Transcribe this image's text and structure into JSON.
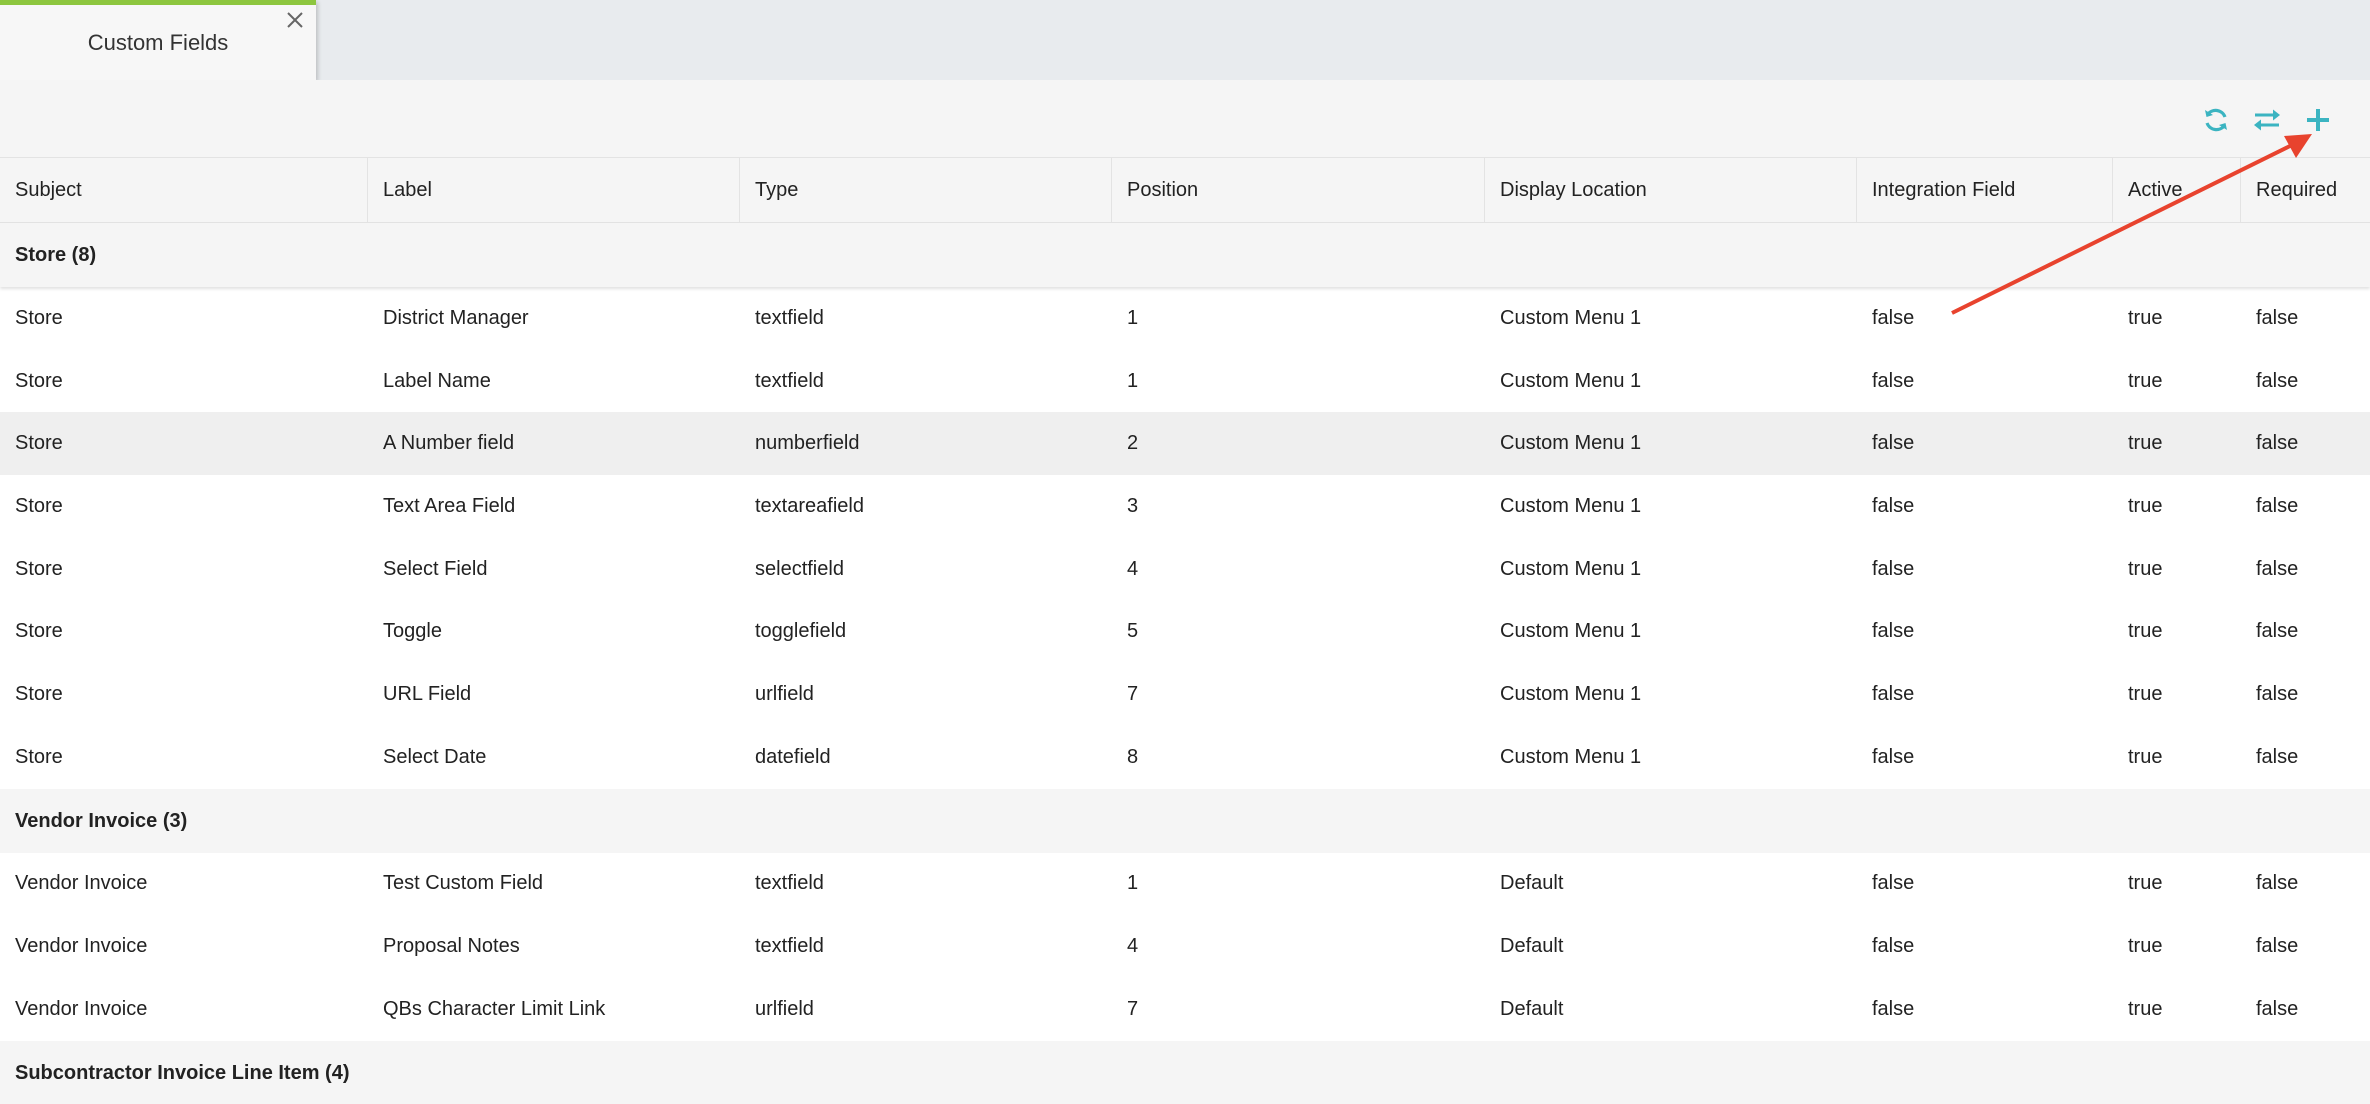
{
  "tab": {
    "label": "Custom Fields"
  },
  "toolbar": {
    "icons": [
      "refresh-icon",
      "swap-icon",
      "plus-icon"
    ],
    "accent": "#3bb4c1"
  },
  "columns": [
    "Subject",
    "Label",
    "Type",
    "Position",
    "Display Location",
    "Integration Field",
    "Active",
    "Required"
  ],
  "groups": [
    {
      "title": "Store (8)",
      "rows": [
        [
          "Store",
          "District Manager",
          "textfield",
          "1",
          "Custom Menu 1",
          "false",
          "true",
          "false"
        ],
        [
          "Store",
          "Label Name",
          "textfield",
          "1",
          "Custom Menu 1",
          "false",
          "true",
          "false"
        ],
        [
          "Store",
          "A Number field",
          "numberfield",
          "2",
          "Custom Menu 1",
          "false",
          "true",
          "false"
        ],
        [
          "Store",
          "Text Area Field",
          "textareafield",
          "3",
          "Custom Menu 1",
          "false",
          "true",
          "false"
        ],
        [
          "Store",
          "Select Field",
          "selectfield",
          "4",
          "Custom Menu 1",
          "false",
          "true",
          "false"
        ],
        [
          "Store",
          "Toggle",
          "togglefield",
          "5",
          "Custom Menu 1",
          "false",
          "true",
          "false"
        ],
        [
          "Store",
          "URL Field",
          "urlfield",
          "7",
          "Custom Menu 1",
          "false",
          "true",
          "false"
        ],
        [
          "Store",
          "Select Date",
          "datefield",
          "8",
          "Custom Menu 1",
          "false",
          "true",
          "false"
        ]
      ]
    },
    {
      "title": "Vendor Invoice (3)",
      "rows": [
        [
          "Vendor Invoice",
          "Test Custom Field",
          "textfield",
          "1",
          "Default",
          "false",
          "true",
          "false"
        ],
        [
          "Vendor Invoice",
          "Proposal Notes",
          "textfield",
          "4",
          "Default",
          "false",
          "true",
          "false"
        ],
        [
          "Vendor Invoice",
          "QBs Character Limit Link",
          "urlfield",
          "7",
          "Default",
          "false",
          "true",
          "false"
        ]
      ]
    },
    {
      "title": "Subcontractor Invoice Line Item (4)",
      "rows": []
    }
  ],
  "annotation": {
    "color": "#e8432e"
  }
}
